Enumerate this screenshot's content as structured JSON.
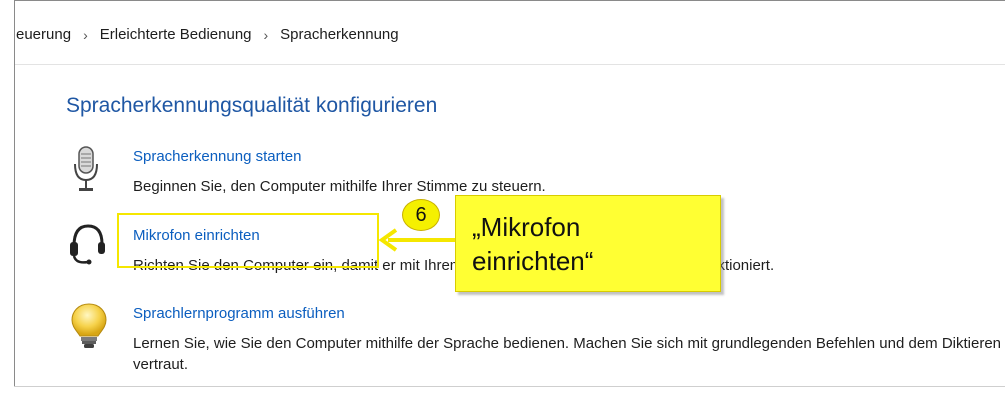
{
  "breadcrumb": {
    "items": [
      "euerung",
      "Erleichterte Bedienung",
      "Spracherkennung"
    ],
    "separator": "›"
  },
  "page": {
    "title": "Spracherkennungsqualität konfigurieren"
  },
  "options": [
    {
      "icon": "microphone-icon",
      "link": "Spracherkennung starten",
      "description": "Beginnen Sie, den Computer mithilfe Ihrer Stimme zu steuern."
    },
    {
      "icon": "headset-icon",
      "link": "Mikrofon einrichten",
      "description": "Richten Sie den Computer ein, damit er mit Ihrem Mikrofon für die Spracherkennung funktioniert."
    },
    {
      "icon": "lightbulb-icon",
      "link": "Sprachlernprogramm ausführen",
      "description": "Lernen Sie, wie Sie den Computer mithilfe der Sprache bedienen. Machen Sie sich mit grundlegenden Befehlen und dem Diktieren vertraut."
    }
  ],
  "annotation": {
    "step_number": "6",
    "callout_line1": "„Mikrofon",
    "callout_line2": "einrichten“",
    "color": "#f5f000"
  },
  "colors": {
    "title": "#1f57a4",
    "link": "#0b5ebf"
  }
}
